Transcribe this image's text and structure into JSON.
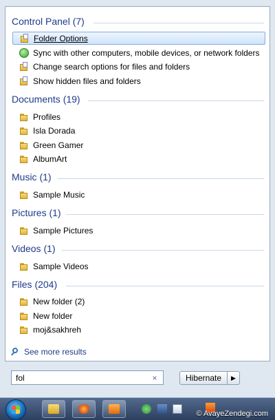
{
  "groups": [
    {
      "header": "Control Panel (7)",
      "items": [
        {
          "label": "Folder Options",
          "icon": "folder-options-icon"
        },
        {
          "label": "Sync with other computers, mobile devices, or network folders",
          "icon": "sync-icon"
        },
        {
          "label": "Change search options for files and folders",
          "icon": "folder-options-icon"
        },
        {
          "label": "Show hidden files and folders",
          "icon": "folder-options-icon"
        }
      ]
    },
    {
      "header": "Documents (19)",
      "items": [
        {
          "label": "Profiles",
          "icon": "folder-icon"
        },
        {
          "label": "Isla Dorada",
          "icon": "folder-icon"
        },
        {
          "label": "Green Gamer",
          "icon": "folder-icon"
        },
        {
          "label": "AlbumArt",
          "icon": "folder-icon"
        }
      ]
    },
    {
      "header": "Music (1)",
      "items": [
        {
          "label": "Sample Music",
          "icon": "folder-icon"
        }
      ]
    },
    {
      "header": "Pictures (1)",
      "items": [
        {
          "label": "Sample Pictures",
          "icon": "folder-icon"
        }
      ]
    },
    {
      "header": "Videos (1)",
      "items": [
        {
          "label": "Sample Videos",
          "icon": "folder-icon"
        }
      ]
    },
    {
      "header": "Files (204)",
      "items": [
        {
          "label": "New folder (2)",
          "icon": "folder-icon"
        },
        {
          "label": "New folder",
          "icon": "folder-icon"
        },
        {
          "label": "moj&sakhreh",
          "icon": "folder-icon"
        }
      ]
    }
  ],
  "see_more": "See more results",
  "search": {
    "value": "fol",
    "clear": "×"
  },
  "power": {
    "label": "Hibernate",
    "arrow": "▶"
  },
  "watermark": "© AvayeZendegi.com",
  "colors": {
    "header": "#1e3a8a",
    "selection": "#cfe3fa",
    "taskbar": "#2c3f5e"
  }
}
